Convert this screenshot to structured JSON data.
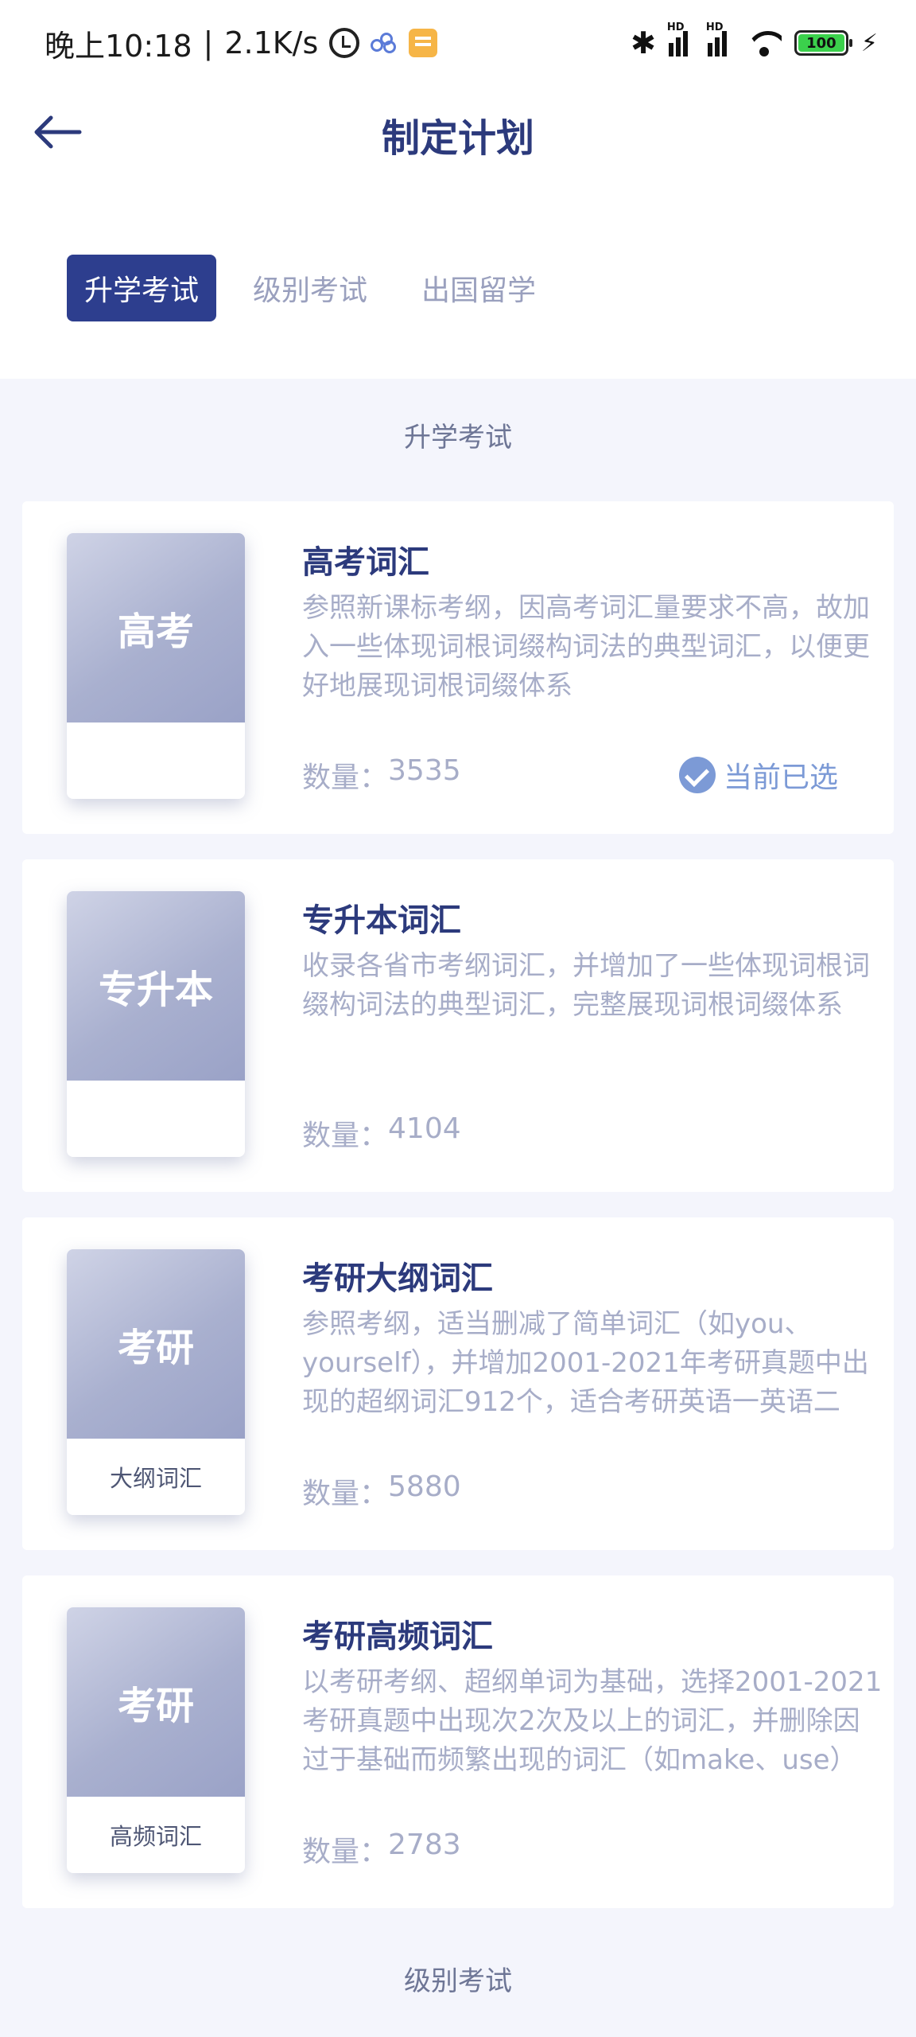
{
  "status_bar": {
    "time": "晚上10:18",
    "separator": "|",
    "speed": "2.1K/s",
    "battery": "100",
    "hd1": "HD",
    "hd2": "HD"
  },
  "header": {
    "title": "制定计划"
  },
  "tabs": [
    {
      "label": "升学考试",
      "active": true
    },
    {
      "label": "级别考试",
      "active": false
    },
    {
      "label": "出国留学",
      "active": false
    }
  ],
  "sections": [
    {
      "title": "升学考试"
    },
    {
      "title": "级别考试"
    }
  ],
  "cards": [
    {
      "cover_text": "高考",
      "cover_sub": "",
      "title": "高考词汇",
      "description": "参照新课标考纲，因高考词汇量要求不高，故加入一些体现词根词缀构词法的典型词汇，以便更好地展现词根词缀体系",
      "count_label": "数量：",
      "count": "3535",
      "selected_label": "当前已选"
    },
    {
      "cover_text": "专升本",
      "cover_sub": "",
      "title": "专升本词汇",
      "description": "收录各省市考纲词汇，并增加了一些体现词根词缀构词法的典型词汇，完整展现词根词缀体系",
      "count_label": "数量：",
      "count": "4104"
    },
    {
      "cover_text": "考研",
      "cover_sub": "大纲词汇",
      "title": "考研大纲词汇",
      "description": "参照考纲，适当删减了简单词汇（如you、yourself），并增加2001-2021年考研真题中出现的超纲词汇912个，适合考研英语一英语二",
      "count_label": "数量：",
      "count": "5880"
    },
    {
      "cover_text": "考研",
      "cover_sub": "高频词汇",
      "title": "考研高频词汇",
      "description": "以考研考纲、超纲单词为基础，选择2001-2021考研真题中出现次2次及以上的词汇，并删除因过于基础而频繁出现的词汇（如make、use）",
      "count_label": "数量：",
      "count": "2783"
    }
  ]
}
